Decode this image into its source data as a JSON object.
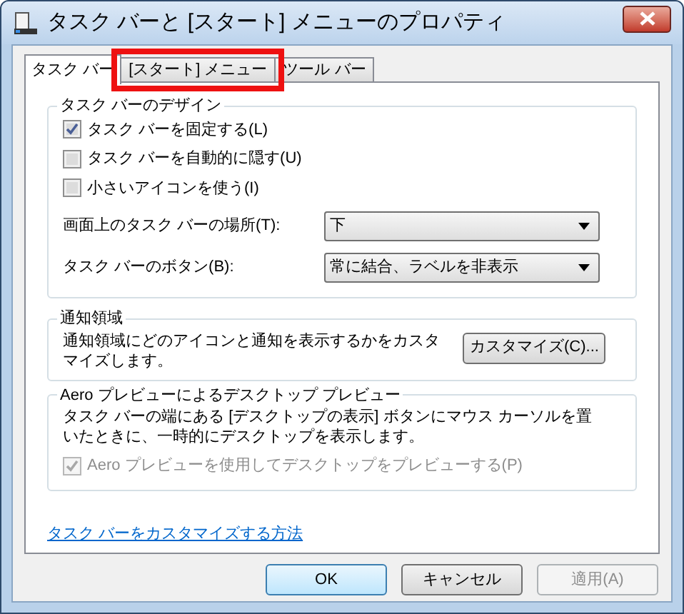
{
  "window": {
    "title": "タスク バーと [スタート] メニューのプロパティ"
  },
  "tabs": [
    {
      "label": "タスク バー",
      "selected": true,
      "highlighted": false
    },
    {
      "label": "[スタート] メニュー",
      "selected": false,
      "highlighted": true
    },
    {
      "label": "ツール バー",
      "selected": false,
      "highlighted": false
    }
  ],
  "design_group": {
    "title": "タスク バーのデザイン",
    "checkboxes": [
      {
        "label": "タスク バーを固定する(L)",
        "checked": true
      },
      {
        "label": "タスク バーを自動的に隠す(U)",
        "checked": false
      },
      {
        "label": "小さいアイコンを使う(I)",
        "checked": false
      }
    ],
    "dropdowns": [
      {
        "label": "画面上のタスク バーの場所(T):",
        "value": "下"
      },
      {
        "label": "タスク バーのボタン(B):",
        "value": "常に結合、ラベルを非表示"
      }
    ]
  },
  "notification_group": {
    "title": "通知領域",
    "text": "通知領域にどのアイコンと通知を表示するかをカスタマイズします。",
    "button": "カスタマイズ(C)..."
  },
  "aero_group": {
    "title": "Aero プレビューによるデスクトップ プレビュー",
    "text": "タスク バーの端にある [デスクトップの表示] ボタンにマウス カーソルを置いたときに、一時的にデスクトップを表示します。",
    "checkbox": {
      "label": "Aero プレビューを使用してデスクトップをプレビューする(P)",
      "checked": true,
      "disabled": true
    }
  },
  "link": "タスク バーをカスタマイズする方法",
  "buttons": [
    {
      "label": "OK",
      "default": true,
      "disabled": false
    },
    {
      "label": "キャンセル",
      "default": false,
      "disabled": false
    },
    {
      "label": "適用(A)",
      "default": false,
      "disabled": true
    }
  ]
}
